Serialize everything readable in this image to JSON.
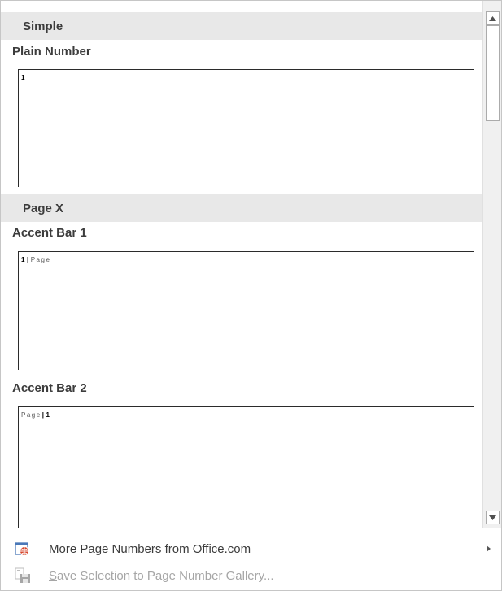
{
  "gallery": {
    "sections": [
      {
        "header": "Simple",
        "items": [
          {
            "title": "Plain Number",
            "preview_number": "1"
          }
        ]
      },
      {
        "header": "Page X",
        "items": [
          {
            "title": "Accent Bar 1",
            "preview_number": "1",
            "preview_separator": "|",
            "preview_word": "Page"
          },
          {
            "title": "Accent Bar 2",
            "preview_word": "Page",
            "preview_separator": "|",
            "preview_number": "1"
          }
        ]
      }
    ]
  },
  "scrollbar": {
    "up_icon": "triangle-up",
    "down_icon": "triangle-down"
  },
  "menu": {
    "more": {
      "label_accel": "M",
      "label_rest": "ore Page Numbers from Office.com",
      "icon": "office-globe-icon",
      "has_submenu": true
    },
    "save": {
      "label_accel": "S",
      "label_rest": "ave Selection to Page Number Gallery...",
      "icon": "save-to-gallery-icon",
      "enabled": false
    }
  },
  "colors": {
    "section_header_bg": "#e8e8e8",
    "text": "#3c3c3c",
    "disabled_text": "#a6a6a6"
  }
}
